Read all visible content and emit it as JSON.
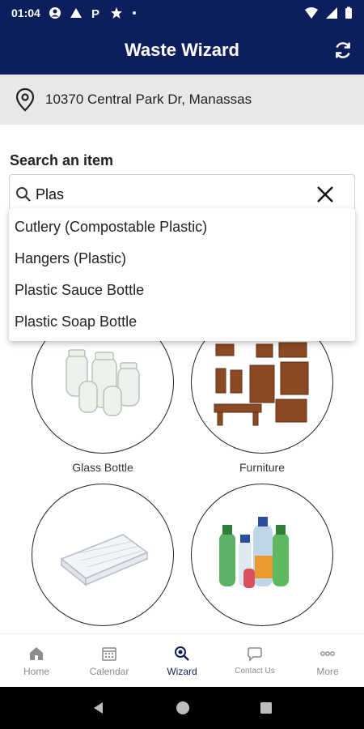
{
  "status_bar": {
    "time": "01:04"
  },
  "app_bar": {
    "title": "Waste Wizard"
  },
  "address": {
    "text": "10370 Central Park Dr, Manassas"
  },
  "search": {
    "label": "Search an item",
    "value": "Plas"
  },
  "suggestions": [
    "Cutlery (Compostable Plastic)",
    "Hangers (Plastic)",
    "Plastic Sauce Bottle",
    "Plastic Soap Bottle"
  ],
  "categories": [
    {
      "label": "Glass Bottle"
    },
    {
      "label": "Furniture"
    },
    {
      "label": ""
    },
    {
      "label": ""
    }
  ],
  "bottom_nav": [
    {
      "label": "Home",
      "icon": "home-icon"
    },
    {
      "label": "Calendar",
      "icon": "calendar-icon"
    },
    {
      "label": "Wizard",
      "icon": "wizard-icon"
    },
    {
      "label": "Contact Us",
      "icon": "chat-icon"
    },
    {
      "label": "More",
      "icon": "more-icon"
    }
  ],
  "colors": {
    "primary": "#0c1f5c",
    "nav_inactive": "#8c8c8c",
    "address_bg": "#e8e8e8"
  }
}
